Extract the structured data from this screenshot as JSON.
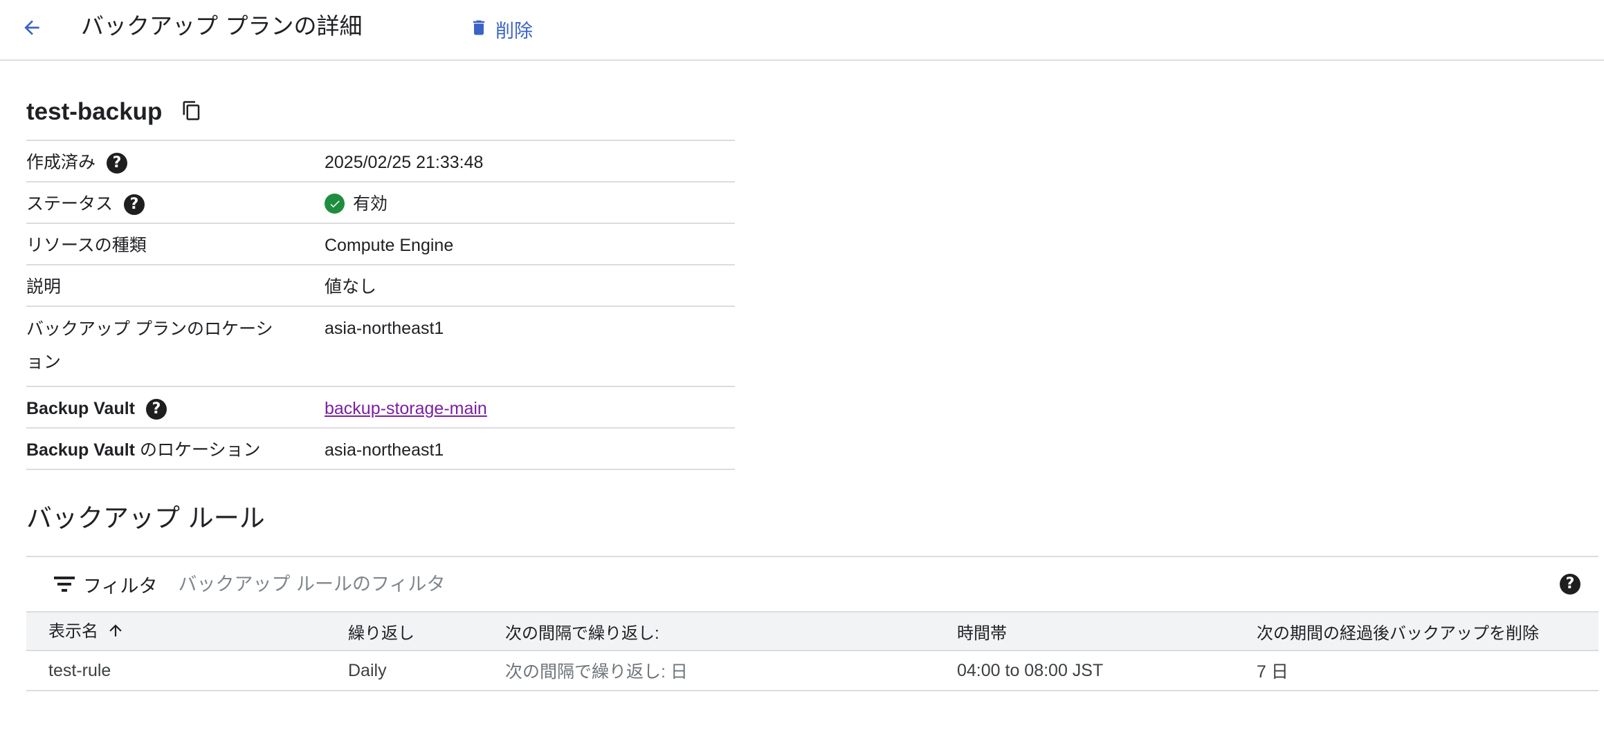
{
  "header": {
    "title": "バックアップ プランの詳細",
    "delete_label": "削除"
  },
  "plan": {
    "name": "test-backup"
  },
  "details": {
    "created_label": "作成済み",
    "created_value": "2025/02/25 21:33:48",
    "status_label": "ステータス",
    "status_value": "有効",
    "resource_type_label": "リソースの種類",
    "resource_type_value": "Compute Engine",
    "description_label": "説明",
    "description_value": "値なし",
    "plan_location_label": "バックアップ プランのロケーション",
    "plan_location_value": "asia-northeast1",
    "vault_label": "Backup Vault",
    "vault_value": "backup-storage-main",
    "vault_location_label_bold": "Backup Vault",
    "vault_location_label_rest": " のロケーション",
    "vault_location_value": "asia-northeast1"
  },
  "rules": {
    "section_title": "バックアップ ルール",
    "filter_label": "フィルタ",
    "filter_placeholder": "バックアップ ルールのフィルタ",
    "columns": {
      "display_name": "表示名",
      "recurrence": "繰り返し",
      "interval": "次の間隔で繰り返し:",
      "window": "時間帯",
      "retention": "次の期間の経過後バックアップを削除"
    },
    "rows": [
      {
        "display_name": "test-rule",
        "recurrence": "Daily",
        "interval": "次の間隔で繰り返し: 日",
        "window": "04:00 to 08:00 JST",
        "retention": "7 日"
      }
    ]
  },
  "colors": {
    "accent": "#3b63c4",
    "status_ok": "#1e8e3e",
    "link_visited": "#7b1fa2",
    "divider": "#dadce0",
    "header_bg": "#f1f3f4"
  }
}
